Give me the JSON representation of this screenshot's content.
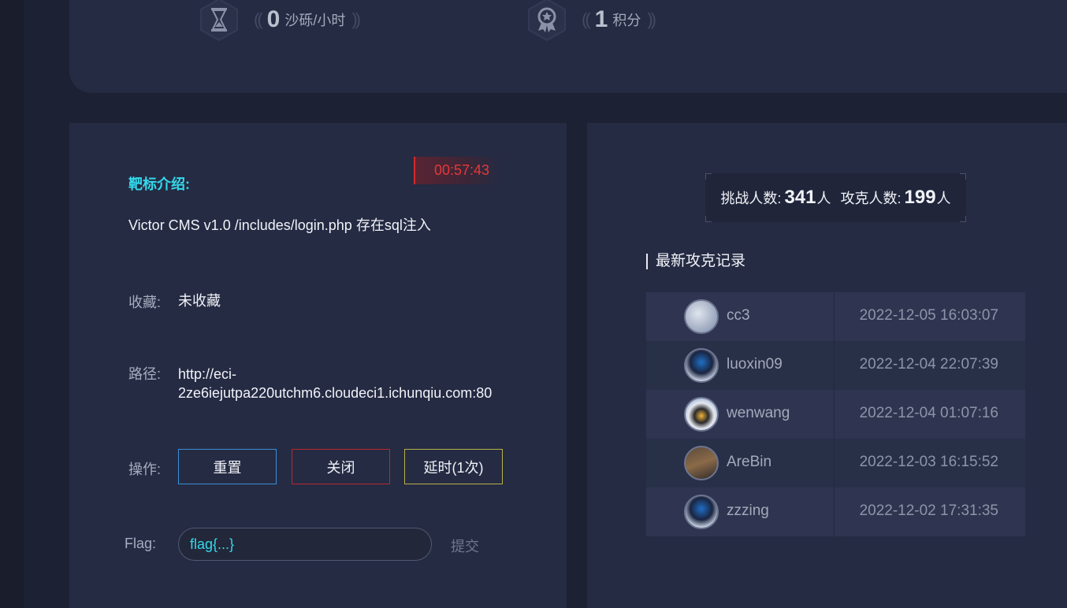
{
  "stats": [
    {
      "icon": "hourglass-icon",
      "value": "0",
      "unit": "沙砾/小时"
    },
    {
      "icon": "award-badge-icon",
      "value": "1",
      "unit": "积分"
    }
  ],
  "target": {
    "section_title": "靶标介绍:",
    "timer": "00:57:43",
    "description": "Victor CMS v1.0 /includes/login.php 存在sql注入",
    "favorite_label": "收藏:",
    "favorite_value": "未收藏",
    "path_label": "路径:",
    "path_line1": "http://eci-",
    "path_line2": "2ze6iejutpa220utchm6.cloudeci1.ichunqiu.com:80",
    "ops_label": "操作:",
    "buttons": {
      "reset": "重置",
      "close": "关闭",
      "delay": "延时(1次)"
    },
    "flag_label": "Flag:",
    "flag_value": "flag{...}",
    "submit_label": "提交"
  },
  "counts": {
    "challengers_label": "挑战人数:",
    "challengers_value": "341",
    "challengers_unit": "人",
    "solvers_label": "攻克人数:",
    "solvers_value": "199",
    "solvers_unit": "人"
  },
  "records_title": "最新攻克记录",
  "records": [
    {
      "user": "cc3",
      "time": "2022-12-05 16:03:07"
    },
    {
      "user": "luoxin09",
      "time": "2022-12-04 22:07:39"
    },
    {
      "user": "wenwang",
      "time": "2022-12-04 01:07:16"
    },
    {
      "user": "AreBin",
      "time": "2022-12-03 16:15:52"
    },
    {
      "user": "zzzing",
      "time": "2022-12-02 17:31:35"
    }
  ],
  "colors": {
    "accent_cyan": "#33d9ec",
    "timer_red": "#e53838",
    "reset_blue": "#3a8fd6",
    "close_red": "#b8282f",
    "delay_yellow": "#b8b04a"
  }
}
